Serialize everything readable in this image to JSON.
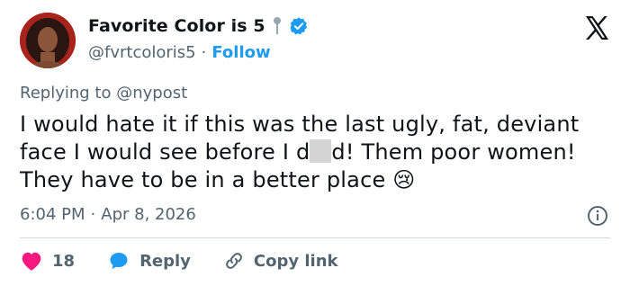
{
  "author": {
    "display_name": "Favorite Color is 5",
    "handle": "@fvrtcoloris5",
    "separator": "·",
    "follow_label": "Follow"
  },
  "tweet": {
    "replying_prefix": "Replying to",
    "replying_mention": "@nypost",
    "text_part1": "I would hate it if this was the last ugly, fat, deviant face I would see before I d",
    "text_part2": "d! Them poor women! They have to be in a better place",
    "emoji": "😢",
    "time": "6:04 PM",
    "meta_separator": "·",
    "date": "Apr 8, 2026"
  },
  "actions": {
    "likes": "18",
    "reply_label": "Reply",
    "copy_label": "Copy link"
  },
  "colors": {
    "accent": "#1d9bf0",
    "like": "#f91880",
    "secondary_text": "#536471"
  },
  "icons": [
    "pin-icon",
    "verified-badge-icon",
    "x-logo-icon",
    "info-icon",
    "heart-icon",
    "reply-icon",
    "link-icon"
  ]
}
